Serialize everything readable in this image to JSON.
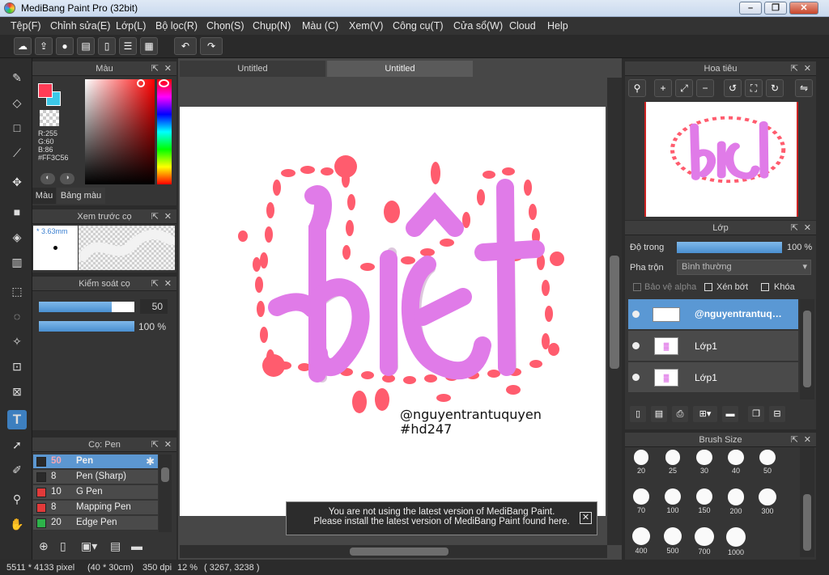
{
  "window": {
    "title": "MediBang Paint Pro (32bit)"
  },
  "menu": [
    "Tệp(F)",
    "Chỉnh sửa(E)",
    "Lớp(L)",
    "Bộ lọc(R)",
    "Chọn(S)",
    "Chụp(N)",
    "Màu (C)",
    "Xem(V)",
    "Công cụ(T)",
    "Cửa sổ(W)",
    "Cloud",
    "Help"
  ],
  "toolbar_icons": [
    "cloud-icon",
    "share-icon",
    "comment-icon",
    "speech-bubble-icon",
    "page-icon",
    "page-list-icon",
    "panel-layout-icon",
    "undo-icon",
    "redo-icon"
  ],
  "tools": [
    "brush-icon",
    "eraser-icon",
    "rectangle-icon",
    "fill-brush-icon",
    "move-icon",
    "fill-rect-icon",
    "bucket-icon",
    "gradient-icon",
    "select-rect-icon",
    "lasso-icon",
    "magic-wand-icon",
    "select-pen-icon",
    "select-eraser-icon",
    "text-icon",
    "operation-icon",
    "eyedropper-icon",
    "pen-icon",
    "hand-icon"
  ],
  "color_panel": {
    "title": "Màu",
    "r": "R:255",
    "g": "G:60",
    "b": "B:86",
    "hex": "#FF3C56",
    "tab_color": "Màu",
    "tab_palette": "Bảng màu",
    "primary": "#ff3c56",
    "secondary": "#3cc8e8"
  },
  "brush_preview": {
    "title": "Xem trước cọ",
    "size": "* 3.63mm"
  },
  "brush_control": {
    "title": "Kiểm soát cọ",
    "size_value": "50",
    "opacity_value": "100 %",
    "size_fraction": 0.76,
    "opacity_fraction": 1.0
  },
  "brush_list": {
    "title": "Cọ: Pen",
    "items": [
      {
        "size": "50",
        "name": "Pen",
        "color": "#2a2a2a",
        "selected": true
      },
      {
        "size": "8",
        "name": "Pen (Sharp)",
        "color": "#2a2a2a"
      },
      {
        "size": "10",
        "name": "G Pen",
        "color": "#e23a3a"
      },
      {
        "size": "8",
        "name": "Mapping Pen",
        "color": "#e23a3a"
      },
      {
        "size": "20",
        "name": "Edge Pen",
        "color": "#2db34a"
      }
    ]
  },
  "documents": {
    "tabs": [
      "Untitled",
      "Untitled"
    ],
    "active": 1
  },
  "canvas": {
    "word": "biêt",
    "watermark_line1": "@nguyentrantuquyen",
    "watermark_line2": "#hd247"
  },
  "notification": {
    "line1": "You are not using the latest version of MediBang Paint.",
    "line2": "Please install the latest version of MediBang Paint found here.",
    "close": "✕"
  },
  "navigator": {
    "title": "Hoa tiêu"
  },
  "layers": {
    "title": "Lớp",
    "opacity_label": "Độ trong",
    "opacity_value": "100 %",
    "blend_label": "Pha trộn",
    "blend_value": "Bình thường",
    "protect_alpha": "Bảo vệ alpha",
    "clipping": "Xén bớt",
    "lock": "Khóa",
    "items": [
      {
        "name": "@nguyentrantuq…",
        "selected": true
      },
      {
        "name": "Lớp1"
      },
      {
        "name": "Lớp1"
      }
    ]
  },
  "brush_size": {
    "title": "Brush Size",
    "sizes": [
      "20",
      "25",
      "30",
      "40",
      "50",
      "70",
      "100",
      "150",
      "200",
      "300",
      "400",
      "500",
      "700",
      "1000"
    ]
  },
  "status": {
    "pixels": "5511 * 4133 pixel",
    "cm": "(40 * 30cm)",
    "dpi": "350 dpi",
    "zoom": "12 %",
    "coords": "( 3267, 3238 )"
  }
}
